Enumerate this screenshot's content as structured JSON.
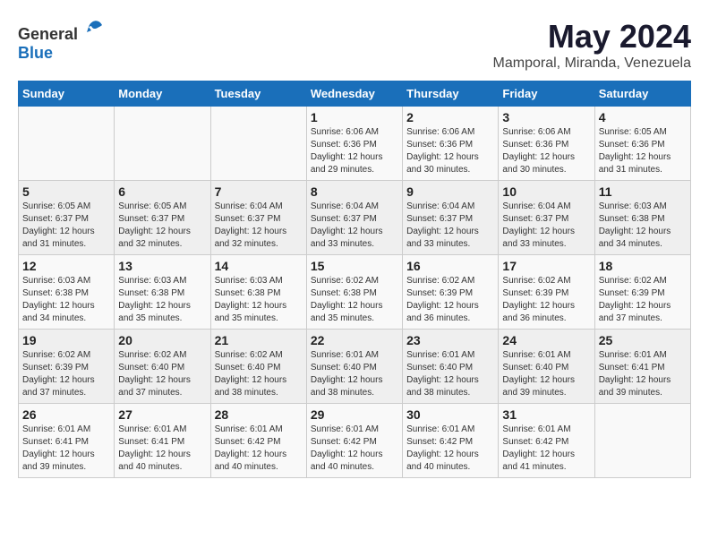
{
  "header": {
    "logo_general": "General",
    "logo_blue": "Blue",
    "month_title": "May 2024",
    "location": "Mamporal, Miranda, Venezuela"
  },
  "weekdays": [
    "Sunday",
    "Monday",
    "Tuesday",
    "Wednesday",
    "Thursday",
    "Friday",
    "Saturday"
  ],
  "weeks": [
    [
      {
        "day": "",
        "info": ""
      },
      {
        "day": "",
        "info": ""
      },
      {
        "day": "",
        "info": ""
      },
      {
        "day": "1",
        "info": "Sunrise: 6:06 AM\nSunset: 6:36 PM\nDaylight: 12 hours\nand 29 minutes."
      },
      {
        "day": "2",
        "info": "Sunrise: 6:06 AM\nSunset: 6:36 PM\nDaylight: 12 hours\nand 30 minutes."
      },
      {
        "day": "3",
        "info": "Sunrise: 6:06 AM\nSunset: 6:36 PM\nDaylight: 12 hours\nand 30 minutes."
      },
      {
        "day": "4",
        "info": "Sunrise: 6:05 AM\nSunset: 6:36 PM\nDaylight: 12 hours\nand 31 minutes."
      }
    ],
    [
      {
        "day": "5",
        "info": "Sunrise: 6:05 AM\nSunset: 6:37 PM\nDaylight: 12 hours\nand 31 minutes."
      },
      {
        "day": "6",
        "info": "Sunrise: 6:05 AM\nSunset: 6:37 PM\nDaylight: 12 hours\nand 32 minutes."
      },
      {
        "day": "7",
        "info": "Sunrise: 6:04 AM\nSunset: 6:37 PM\nDaylight: 12 hours\nand 32 minutes."
      },
      {
        "day": "8",
        "info": "Sunrise: 6:04 AM\nSunset: 6:37 PM\nDaylight: 12 hours\nand 33 minutes."
      },
      {
        "day": "9",
        "info": "Sunrise: 6:04 AM\nSunset: 6:37 PM\nDaylight: 12 hours\nand 33 minutes."
      },
      {
        "day": "10",
        "info": "Sunrise: 6:04 AM\nSunset: 6:37 PM\nDaylight: 12 hours\nand 33 minutes."
      },
      {
        "day": "11",
        "info": "Sunrise: 6:03 AM\nSunset: 6:38 PM\nDaylight: 12 hours\nand 34 minutes."
      }
    ],
    [
      {
        "day": "12",
        "info": "Sunrise: 6:03 AM\nSunset: 6:38 PM\nDaylight: 12 hours\nand 34 minutes."
      },
      {
        "day": "13",
        "info": "Sunrise: 6:03 AM\nSunset: 6:38 PM\nDaylight: 12 hours\nand 35 minutes."
      },
      {
        "day": "14",
        "info": "Sunrise: 6:03 AM\nSunset: 6:38 PM\nDaylight: 12 hours\nand 35 minutes."
      },
      {
        "day": "15",
        "info": "Sunrise: 6:02 AM\nSunset: 6:38 PM\nDaylight: 12 hours\nand 35 minutes."
      },
      {
        "day": "16",
        "info": "Sunrise: 6:02 AM\nSunset: 6:39 PM\nDaylight: 12 hours\nand 36 minutes."
      },
      {
        "day": "17",
        "info": "Sunrise: 6:02 AM\nSunset: 6:39 PM\nDaylight: 12 hours\nand 36 minutes."
      },
      {
        "day": "18",
        "info": "Sunrise: 6:02 AM\nSunset: 6:39 PM\nDaylight: 12 hours\nand 37 minutes."
      }
    ],
    [
      {
        "day": "19",
        "info": "Sunrise: 6:02 AM\nSunset: 6:39 PM\nDaylight: 12 hours\nand 37 minutes."
      },
      {
        "day": "20",
        "info": "Sunrise: 6:02 AM\nSunset: 6:40 PM\nDaylight: 12 hours\nand 37 minutes."
      },
      {
        "day": "21",
        "info": "Sunrise: 6:02 AM\nSunset: 6:40 PM\nDaylight: 12 hours\nand 38 minutes."
      },
      {
        "day": "22",
        "info": "Sunrise: 6:01 AM\nSunset: 6:40 PM\nDaylight: 12 hours\nand 38 minutes."
      },
      {
        "day": "23",
        "info": "Sunrise: 6:01 AM\nSunset: 6:40 PM\nDaylight: 12 hours\nand 38 minutes."
      },
      {
        "day": "24",
        "info": "Sunrise: 6:01 AM\nSunset: 6:40 PM\nDaylight: 12 hours\nand 39 minutes."
      },
      {
        "day": "25",
        "info": "Sunrise: 6:01 AM\nSunset: 6:41 PM\nDaylight: 12 hours\nand 39 minutes."
      }
    ],
    [
      {
        "day": "26",
        "info": "Sunrise: 6:01 AM\nSunset: 6:41 PM\nDaylight: 12 hours\nand 39 minutes."
      },
      {
        "day": "27",
        "info": "Sunrise: 6:01 AM\nSunset: 6:41 PM\nDaylight: 12 hours\nand 40 minutes."
      },
      {
        "day": "28",
        "info": "Sunrise: 6:01 AM\nSunset: 6:42 PM\nDaylight: 12 hours\nand 40 minutes."
      },
      {
        "day": "29",
        "info": "Sunrise: 6:01 AM\nSunset: 6:42 PM\nDaylight: 12 hours\nand 40 minutes."
      },
      {
        "day": "30",
        "info": "Sunrise: 6:01 AM\nSunset: 6:42 PM\nDaylight: 12 hours\nand 40 minutes."
      },
      {
        "day": "31",
        "info": "Sunrise: 6:01 AM\nSunset: 6:42 PM\nDaylight: 12 hours\nand 41 minutes."
      },
      {
        "day": "",
        "info": ""
      }
    ]
  ]
}
